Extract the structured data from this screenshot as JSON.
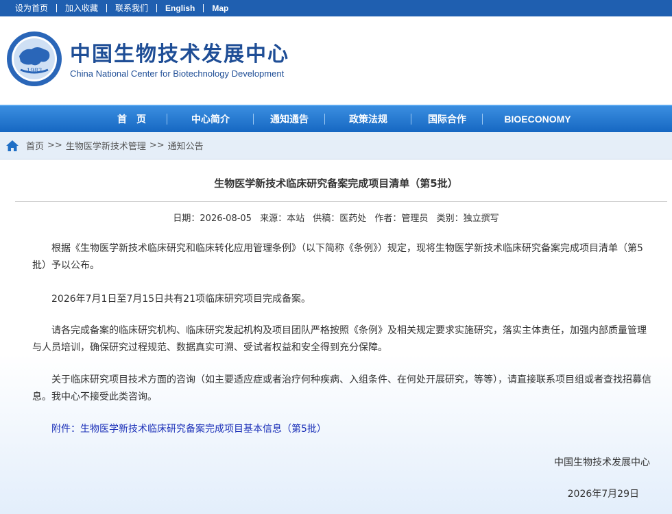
{
  "topbar": {
    "links": [
      "设为首页",
      "加入收藏",
      "联系我们",
      "English",
      "Map"
    ]
  },
  "header": {
    "logo_year": "1983",
    "title_cn": "中国生物技术发展中心",
    "title_en": "China National Center for Biotechnology Development"
  },
  "nav": {
    "items": [
      "首　页",
      "中心简介",
      "通知通告",
      "政策法规",
      "国际合作",
      "BIOECONOMY"
    ]
  },
  "breadcrumb": {
    "items": [
      "首页",
      "生物医学新技术管理",
      "通知公告"
    ],
    "separator": ">>"
  },
  "article": {
    "title": "生物医学新技术临床研究备案完成项目清单（第5批）",
    "meta": {
      "date": "日期：2026-08-05",
      "source": "来源：本站",
      "contributor": "供稿：医药处",
      "author": "作者：管理员",
      "category": "类别：独立撰写"
    },
    "paragraphs": [
      "根据《生物医学新技术临床研究和临床转化应用管理条例》（以下简称《条例》）规定，现将生物医学新技术临床研究备案完成项目清单（第5批）予以公布。",
      "2026年7月1日至7月15日共有21项临床研究项目完成备案。",
      "请各完成备案的临床研究机构、临床研究发起机构及项目团队严格按照《条例》及相关规定要求实施研究，落实主体责任，加强内部质量管理与人员培训，确保研究过程规范、数据真实可溯、受试者权益和安全得到充分保障。",
      "关于临床研究项目技术方面的咨询（如主要适应症或者治疗何种疾病、入组条件、在何处开展研究，等等），请直接联系项目组或者查找招募信息。我中心不接受此类咨询。"
    ],
    "attachment": "附件：生物医学新技术临床研究备案完成项目基本信息（第5批）",
    "signature_org": "中国生物技术发展中心",
    "signature_date": "2026年7月29日"
  },
  "colors": {
    "topbar": "#1f5fb0",
    "nav": "#1667c2",
    "brand_text": "#1f4e96",
    "link": "#1a2fb8"
  }
}
